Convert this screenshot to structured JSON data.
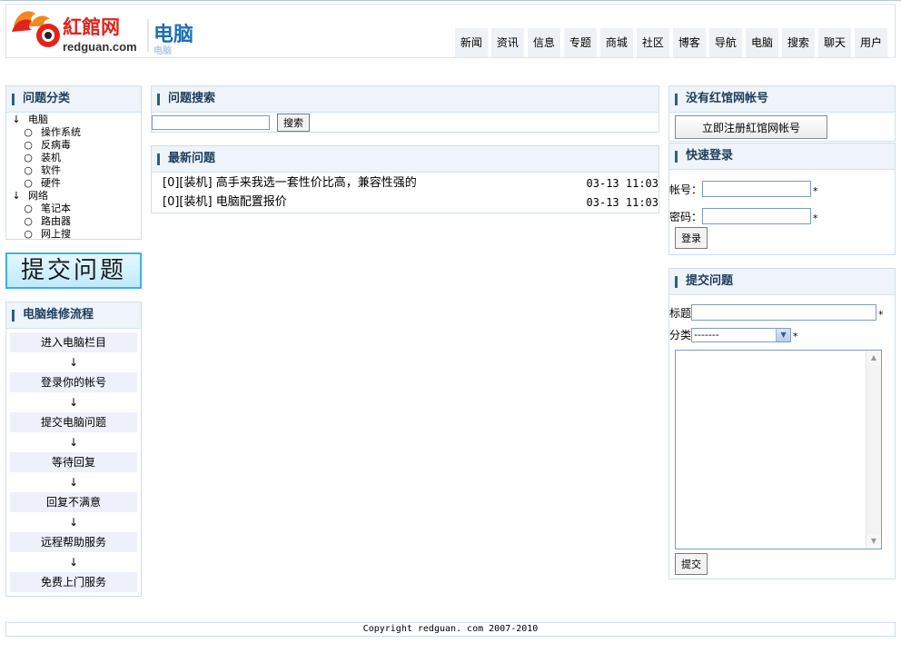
{
  "site": {
    "logo_brand": "紅館网",
    "logo_domain": "redguan.com",
    "logo_section": "电脑"
  },
  "nav": [
    "新闻",
    "资讯",
    "信息",
    "专题",
    "商城",
    "社区",
    "博客",
    "导航",
    "电脑",
    "搜索",
    "聊天",
    "用户"
  ],
  "categories": {
    "title": "问题分类",
    "groups": [
      {
        "label": "电脑",
        "items": [
          "操作系统",
          "反病毒",
          "装机",
          "软件",
          "硬件"
        ]
      },
      {
        "label": "网络",
        "items": [
          "笔记本",
          "路由器",
          "网上搜"
        ]
      }
    ]
  },
  "submit_banner": "提交问题",
  "flow": {
    "title": "电脑维修流程",
    "steps": [
      "进入电脑栏目",
      "登录你的帐号",
      "提交电脑问题",
      "等待回复",
      "回复不满意",
      "远程帮助服务",
      "免费上门服务"
    ],
    "arrow": "↓"
  },
  "search": {
    "title": "问题搜索",
    "input_value": "",
    "button": "搜索"
  },
  "latest": {
    "title": "最新问题",
    "items": [
      {
        "text": "[0][装机] 高手来我选一套性价比高，兼容性强的",
        "time": "03-13 11:03"
      },
      {
        "text": "[0][装机] 电脑配置报价",
        "time": "03-13 11:03"
      }
    ]
  },
  "register": {
    "title": "没有红馆网帐号",
    "button": "立即注册紅馆网帐号"
  },
  "login": {
    "title": "快速登录",
    "account_label": "帐号：",
    "password_label": "密码：",
    "required": "*",
    "button": "登录"
  },
  "ask": {
    "title": "提交问题",
    "title_label": "标题",
    "category_label": "分类",
    "category_selected": "-------",
    "required": "*",
    "button": "提交"
  },
  "footer": "Copyright redguan. com 2007-2010",
  "colors": {
    "panel_title": "#1d3c5d",
    "panel_border": "#cfdfe9",
    "title_bg": "#eef4f9",
    "brand_red": "#e2231a",
    "banner_border": "#3fb0e4"
  }
}
